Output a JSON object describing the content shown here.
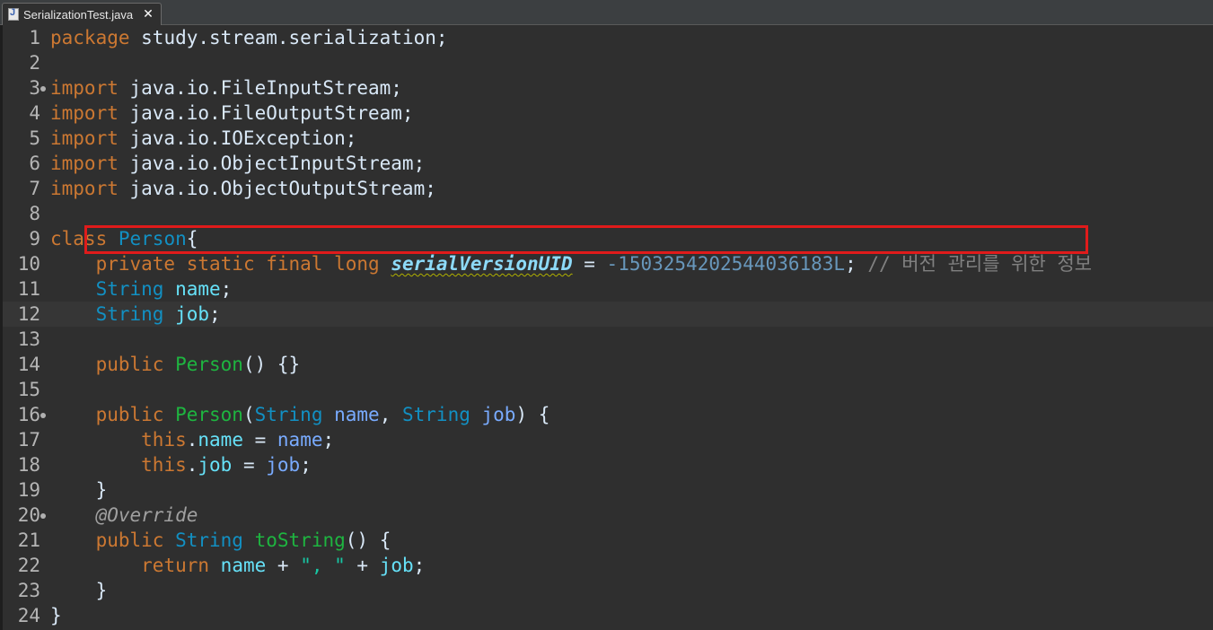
{
  "tab": {
    "label": "SerializationTest.java",
    "close_glyph": "✕",
    "icon": "java-file-icon"
  },
  "editor": {
    "lines": [
      {
        "n": "1"
      },
      {
        "n": "2"
      },
      {
        "n": "3"
      },
      {
        "n": "4"
      },
      {
        "n": "5"
      },
      {
        "n": "6"
      },
      {
        "n": "7"
      },
      {
        "n": "8"
      },
      {
        "n": "9"
      },
      {
        "n": "10"
      },
      {
        "n": "11"
      },
      {
        "n": "12"
      },
      {
        "n": "13"
      },
      {
        "n": "14"
      },
      {
        "n": "15"
      },
      {
        "n": "16"
      },
      {
        "n": "17"
      },
      {
        "n": "18"
      },
      {
        "n": "19"
      },
      {
        "n": "20"
      },
      {
        "n": "21"
      },
      {
        "n": "22"
      },
      {
        "n": "23"
      },
      {
        "n": "24"
      }
    ],
    "tokens": {
      "l1_kw": "package",
      "l1_rest": " study.stream.serialization;",
      "l3_kw": "import",
      "l3_rest": " java.io.FileInputStream;",
      "l4_kw": "import",
      "l4_rest": " java.io.FileOutputStream;",
      "l5_kw": "import",
      "l5_rest": " java.io.IOException;",
      "l6_kw": "import",
      "l6_rest": " java.io.ObjectInputStream;",
      "l7_kw": "import",
      "l7_rest": " java.io.ObjectOutputStream;",
      "l9_kw": "class",
      "l9_cls": "Person",
      "l9_rest": "{",
      "l10_kw": "private static final long",
      "l10_const": "serialVersionUID",
      "l10_eq": " = ",
      "l10_num": "-1503254202544036183L",
      "l10_semi": "; ",
      "l10_cmt": "// 버전 관리를 위한 정보",
      "l11_type": "String",
      "l11_fld": "name",
      "l11_semi": ";",
      "l12_type": "String",
      "l12_fld": "job",
      "l12_semi": ";",
      "l14_kw": "public",
      "l14_def": "Person",
      "l14_rest": "() {}",
      "l16_kw": "public",
      "l16_def": "Person",
      "l16_p1": "(",
      "l16_t1": "String",
      "l16_a1": "name",
      "l16_c": ", ",
      "l16_t2": "String",
      "l16_a2": "job",
      "l16_end": ") {",
      "l17_kw": "this",
      "l17_dot": ".",
      "l17_fld": "name",
      "l17_eq": " = ",
      "l17_prm": "name",
      "l17_semi": ";",
      "l18_kw": "this",
      "l18_dot": ".",
      "l18_fld": "job",
      "l18_eq": " = ",
      "l18_prm": "job",
      "l18_semi": ";",
      "l19_rest": "}",
      "l20_ann": "@Override",
      "l21_kw": "public",
      "l21_type": "String",
      "l21_def": "toString",
      "l21_rest": "() {",
      "l22_kw": "return",
      "l22_f1": "name",
      "l22_plus1": " + ",
      "l22_str": "\", \"",
      "l22_plus2": " + ",
      "l22_f2": "job",
      "l22_semi": ";",
      "l23_rest": "}",
      "l24_rest": "}"
    }
  }
}
